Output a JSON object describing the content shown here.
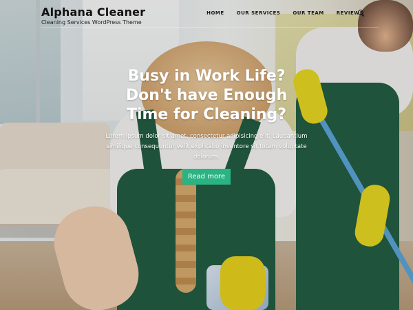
{
  "brand": {
    "title": "Alphana Cleaner",
    "tagline": "Cleaning Services WordPress Theme"
  },
  "nav": {
    "items": [
      "HOME",
      "OUR SERVICES",
      "OUR TEAM",
      "REVIEWS"
    ]
  },
  "hero": {
    "title": "Busy in Work Life? Don't have Enough Time for Cleaning?",
    "text": "Lorem ipsum dolor sit amet, consectetur adipisicing elit. Laudantium similique consequuntur velit explicabo inventore sit totam voluptate dolorum.",
    "button_label": "Read more"
  },
  "icons": {
    "search": "search-icon"
  },
  "colors": {
    "accent": "#2ab383",
    "overall_green": "#1f5a3f",
    "glove_yellow": "#e7d21a"
  }
}
